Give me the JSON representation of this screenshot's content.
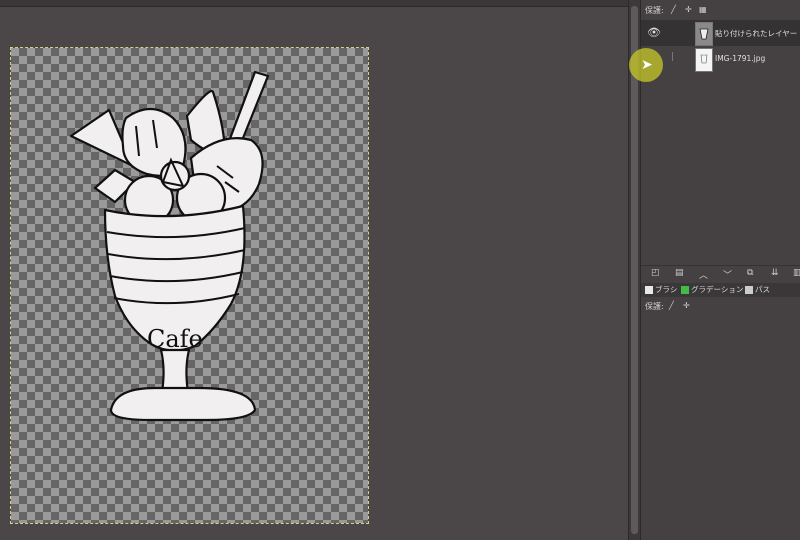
{
  "canvas": {
    "image_label": "Cafe"
  },
  "dock": {
    "lock_label": "保護:",
    "layers": [
      {
        "name": "貼り付けられたレイヤー",
        "visible": true,
        "active": true
      },
      {
        "name": "IMG-1791.jpg",
        "visible": false,
        "active": false
      }
    ],
    "tabs": [
      {
        "label": "ブラシ",
        "color": "#e8e8e8"
      },
      {
        "label": "グラデーション",
        "color": "#44bb44"
      },
      {
        "label": "パス",
        "color": "#cccccc"
      }
    ],
    "lock_label_2": "保護:"
  },
  "colors": {
    "canvas_bg": "#4b4749",
    "highlight": "#c8c828"
  },
  "icons": {
    "eye": "eye-icon",
    "cursor": "mouse-pointer-icon"
  }
}
